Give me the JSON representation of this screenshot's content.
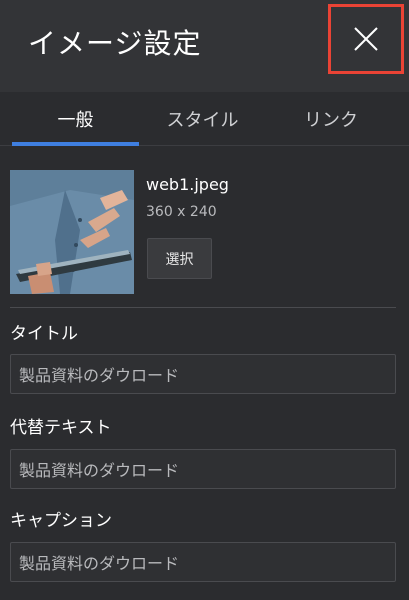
{
  "dialog": {
    "title": "イメージ設定",
    "close_icon": "close-icon",
    "highlight_color": "#ea4335"
  },
  "tabs": [
    {
      "label": "一般",
      "active": true
    },
    {
      "label": "スタイル",
      "active": false
    },
    {
      "label": "リンク",
      "active": false
    }
  ],
  "accent_color": "#3f7fe0",
  "image": {
    "file_name": "web1.jpeg",
    "dimensions": "360 x 240",
    "select_label": "選択"
  },
  "fields": {
    "title": {
      "label": "タイトル",
      "value": "製品資料のダウロード"
    },
    "alt_text": {
      "label": "代替テキスト",
      "value": "製品資料のダウロード"
    },
    "caption": {
      "label": "キャプション",
      "value": "製品資料のダウロード"
    }
  }
}
